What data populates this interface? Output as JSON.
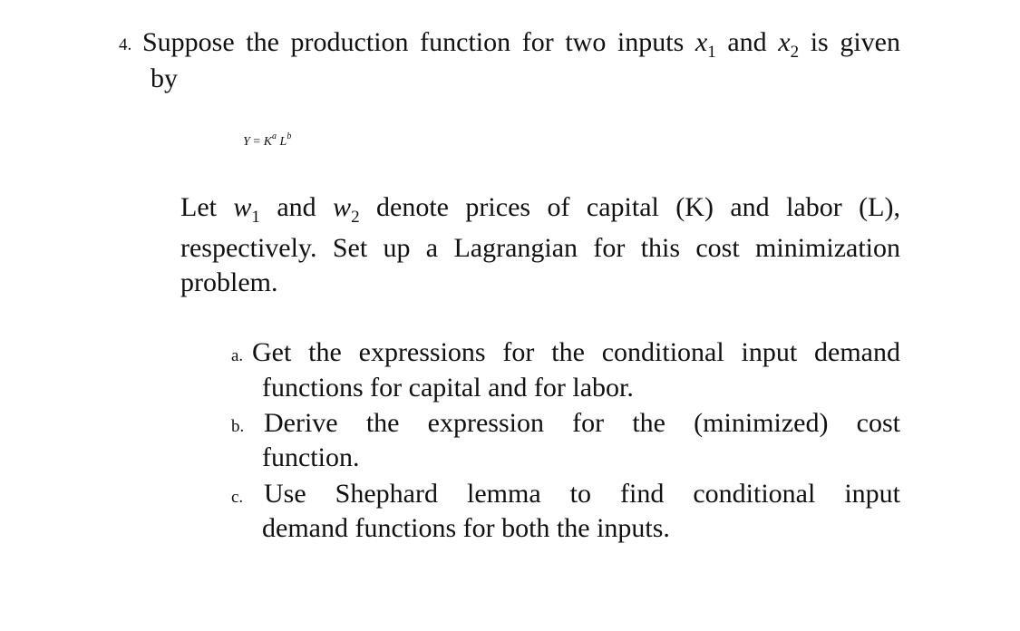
{
  "question": {
    "number": "4.",
    "intro": {
      "line1_pre": "Suppose the production function for two inputs ",
      "var1": "x",
      "var1_sub": "1",
      "mid": " and ",
      "var2": "x",
      "var2_sub": "2",
      "line1_post": " is given",
      "line2": "by"
    },
    "formula": {
      "lhs": "Y",
      "eq": " = ",
      "base1": "K",
      "exp1": "a",
      "base2": "L",
      "exp2": "b"
    },
    "paragraph": {
      "pre": "Let ",
      "w1": "w",
      "w1_sub": "1",
      "and": " and ",
      "w2": "w",
      "w2_sub": "2",
      "line1_post": " denote prices of capital (K) and labor (L),",
      "line2": "respectively. Set up a Lagrangian for this cost minimization",
      "line3": "problem."
    },
    "parts": [
      {
        "label": "a.",
        "lines": [
          "Get the expressions for the conditional input demand",
          "functions for capital and for labor."
        ]
      },
      {
        "label": "b.",
        "lines": [
          "Derive the expression for the (minimized) cost",
          "function."
        ]
      },
      {
        "label": "c.",
        "lines": [
          "Use Shephard lemma to find conditional input",
          "demand functions for both the inputs."
        ]
      }
    ]
  }
}
